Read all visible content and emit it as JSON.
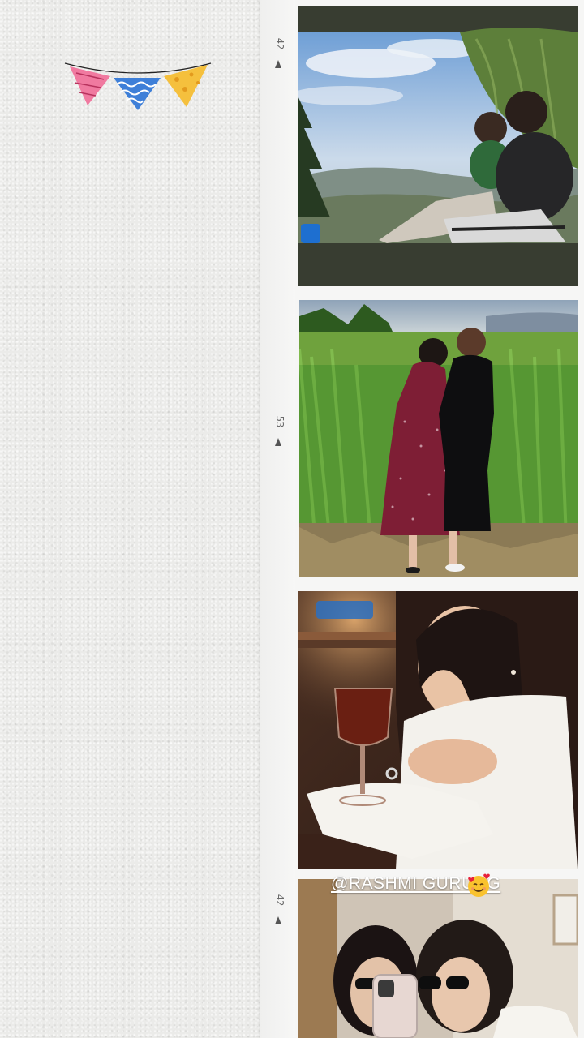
{
  "frames": [
    {
      "label": "42"
    },
    {
      "label": "53"
    },
    {
      "label": "42"
    }
  ],
  "story_caption": {
    "mention": "@RASHMI GURUNG",
    "emoji": "smiling-face-with-hearts-emoji"
  },
  "colors": {
    "paper": "#ebebe9",
    "film_strip": "#f6f6f5",
    "frame_bar": "#383d31",
    "bunting_pink": "#f07aa0",
    "bunting_blue": "#3e7fd8",
    "bunting_yellow": "#f5c03d"
  }
}
